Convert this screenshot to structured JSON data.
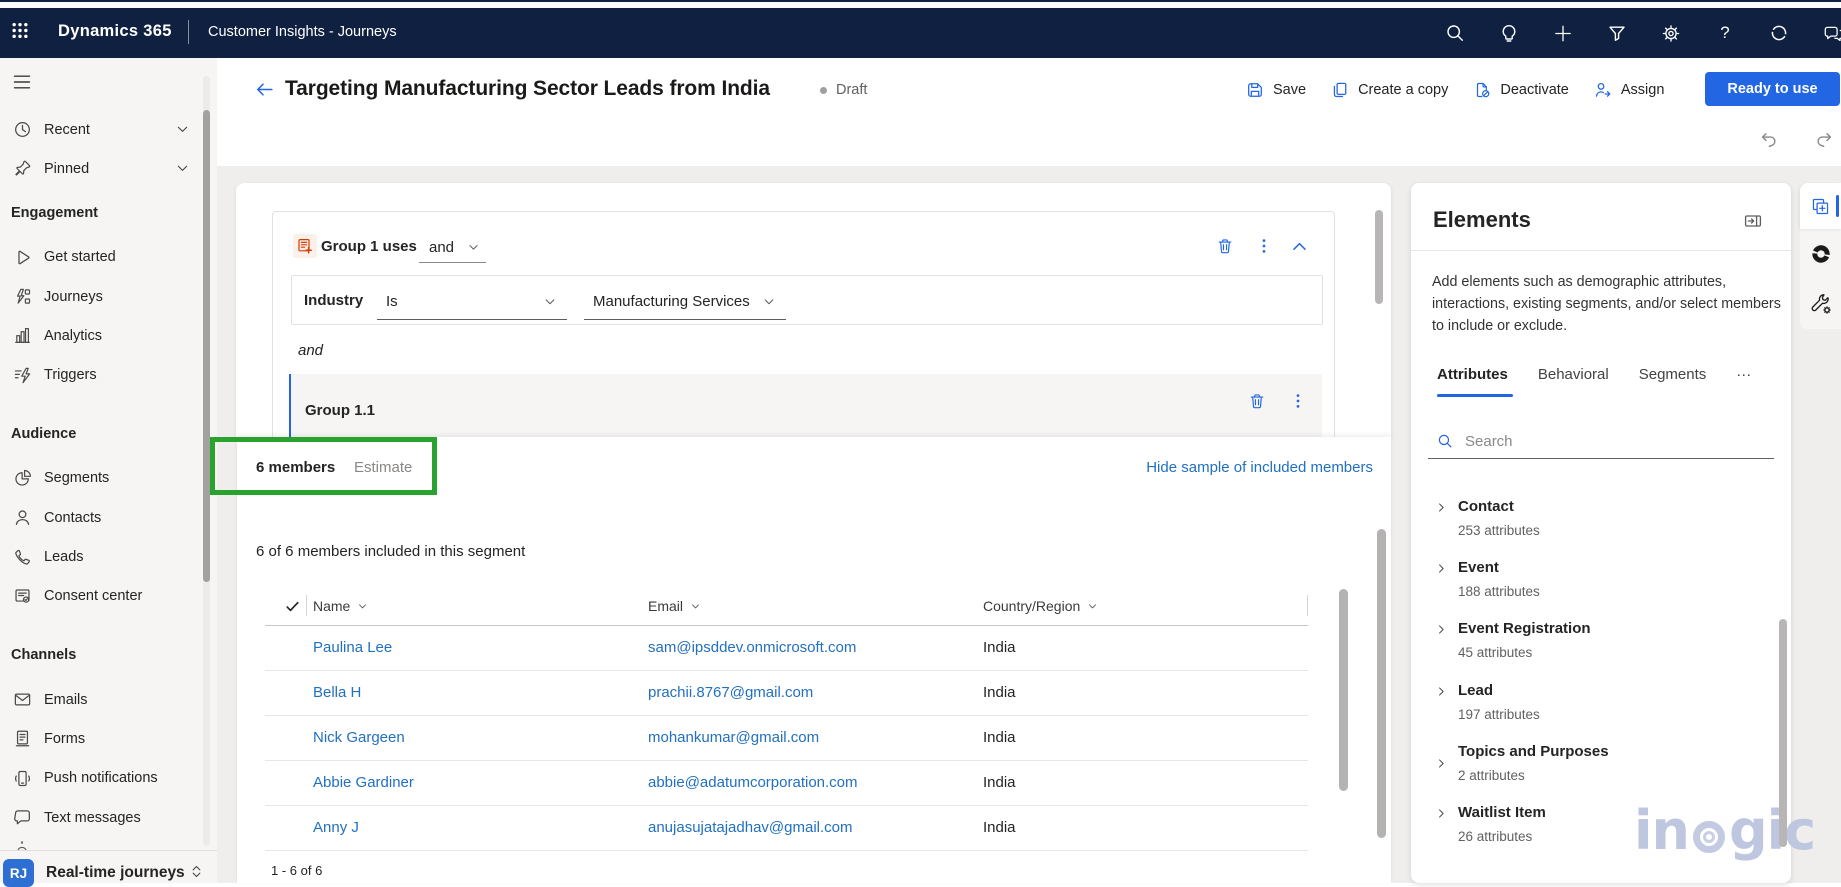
{
  "topbar": {
    "brand": "Dynamics 365",
    "app": "Customer Insights - Journeys",
    "help_glyph": "?"
  },
  "sidebar": {
    "recent": "Recent",
    "pinned": "Pinned",
    "sections": [
      {
        "label": "Engagement",
        "items": [
          {
            "label": "Get started"
          },
          {
            "label": "Journeys"
          },
          {
            "label": "Analytics"
          },
          {
            "label": "Triggers"
          }
        ]
      },
      {
        "label": "Audience",
        "items": [
          {
            "label": "Segments"
          },
          {
            "label": "Contacts"
          },
          {
            "label": "Leads"
          },
          {
            "label": "Consent center"
          }
        ]
      },
      {
        "label": "Channels",
        "items": [
          {
            "label": "Emails"
          },
          {
            "label": "Forms"
          },
          {
            "label": "Push notifications"
          },
          {
            "label": "Text messages"
          }
        ]
      }
    ],
    "area_switcher": {
      "initials": "RJ",
      "label": "Real-time journeys"
    }
  },
  "header": {
    "title": "Targeting Manufacturing Sector Leads from India",
    "status": "Draft",
    "commands": [
      {
        "label": "Save"
      },
      {
        "label": "Create a copy"
      },
      {
        "label": "Deactivate"
      },
      {
        "label": "Assign"
      }
    ],
    "primary_action": "Ready to use"
  },
  "builder": {
    "group_title": "Group 1 uses",
    "group_operator": "and",
    "condition": {
      "field": "Industry",
      "operator": "Is",
      "value": "Manufacturing Services"
    },
    "connector": "and",
    "subgroup_title": "Group 1.1"
  },
  "members": {
    "tab_members": "6 members",
    "tab_estimate": "Estimate",
    "hide_link": "Hide sample of included members",
    "summary": "6 of 6 members included in this segment",
    "columns": {
      "name": "Name",
      "email": "Email",
      "country": "Country/Region"
    },
    "rows": [
      {
        "name": "Paulina Lee",
        "email": "sam@ipsddev.onmicrosoft.com",
        "country": "India"
      },
      {
        "name": "Bella H",
        "email": "prachii.8767@gmail.com",
        "country": "India"
      },
      {
        "name": "Nick Gargeen",
        "email": "mohankumar@gmail.com",
        "country": "India"
      },
      {
        "name": "Abbie Gardiner",
        "email": "abbie@adatumcorporation.com",
        "country": "India"
      },
      {
        "name": "Anny J",
        "email": "anujasujatajadhav@gmail.com",
        "country": "India"
      }
    ],
    "pagination": "1 - 6 of 6"
  },
  "elements_panel": {
    "title": "Elements",
    "description": "Add elements such as demographic attributes, interactions, existing segments, and/or select members to include or exclude.",
    "tabs": [
      {
        "label": "Attributes",
        "active": true
      },
      {
        "label": "Behavioral",
        "active": false
      },
      {
        "label": "Segments",
        "active": false
      },
      {
        "label": "···",
        "active": false
      }
    ],
    "search_placeholder": "Search",
    "groups": [
      {
        "name": "Contact",
        "count": "253 attributes"
      },
      {
        "name": "Event",
        "count": "188 attributes"
      },
      {
        "name": "Event Registration",
        "count": "45 attributes"
      },
      {
        "name": "Lead",
        "count": "197 attributes"
      },
      {
        "name": "Topics and Purposes",
        "count": "2 attributes"
      },
      {
        "name": "Waitlist Item",
        "count": "26 attributes"
      }
    ]
  },
  "watermark": {
    "prefix": "in",
    "suffix": "gic"
  },
  "colors": {
    "navy": "#0f2040",
    "accent": "#2266e3",
    "green": "#2aa32e",
    "link": "#2270c0"
  }
}
